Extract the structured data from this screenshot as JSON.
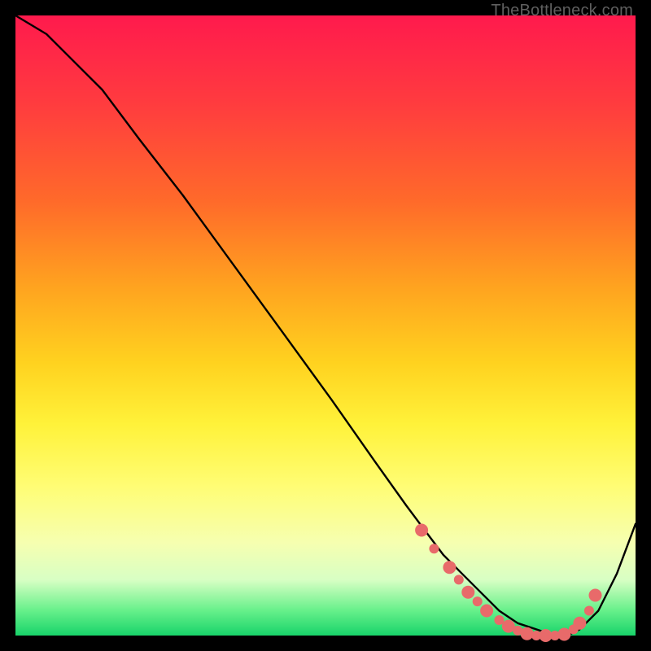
{
  "attribution": "TheBottleneck.com",
  "colors": {
    "dot": "#e86a6a",
    "line": "#000000",
    "gradient_top": "#ff1a4d",
    "gradient_bottom": "#18d36a"
  },
  "chart_data": {
    "type": "line",
    "title": "",
    "xlabel": "",
    "ylabel": "",
    "xlim": [
      0,
      100
    ],
    "ylim": [
      0,
      100
    ],
    "grid": false,
    "legend": false,
    "series": [
      {
        "name": "curve",
        "x": [
          0,
          5,
          9,
          14,
          20,
          27,
          35,
          43,
          51,
          58,
          63,
          66,
          69,
          72,
          75,
          78,
          81,
          84,
          87,
          89,
          91,
          94,
          97,
          100
        ],
        "y": [
          100,
          97,
          93,
          88,
          80,
          71,
          60,
          49,
          38,
          28,
          21,
          17,
          13,
          10,
          7,
          4,
          2,
          1,
          0,
          0,
          1,
          4,
          10,
          18
        ]
      }
    ],
    "markers": [
      {
        "x": 65.5,
        "y": 17.0,
        "size": "big"
      },
      {
        "x": 67.5,
        "y": 14.0,
        "size": "small"
      },
      {
        "x": 70.0,
        "y": 11.0,
        "size": "big"
      },
      {
        "x": 71.5,
        "y": 9.0,
        "size": "small"
      },
      {
        "x": 73.0,
        "y": 7.0,
        "size": "big"
      },
      {
        "x": 74.5,
        "y": 5.5,
        "size": "small"
      },
      {
        "x": 76.0,
        "y": 4.0,
        "size": "big"
      },
      {
        "x": 78.0,
        "y": 2.5,
        "size": "small"
      },
      {
        "x": 79.5,
        "y": 1.5,
        "size": "big"
      },
      {
        "x": 81.0,
        "y": 0.8,
        "size": "small"
      },
      {
        "x": 82.5,
        "y": 0.3,
        "size": "big"
      },
      {
        "x": 84.0,
        "y": 0.0,
        "size": "small"
      },
      {
        "x": 85.5,
        "y": 0.0,
        "size": "big"
      },
      {
        "x": 87.0,
        "y": 0.0,
        "size": "small"
      },
      {
        "x": 88.5,
        "y": 0.2,
        "size": "big"
      },
      {
        "x": 90.0,
        "y": 1.0,
        "size": "small"
      },
      {
        "x": 91.0,
        "y": 2.0,
        "size": "big"
      },
      {
        "x": 92.5,
        "y": 4.0,
        "size": "small"
      },
      {
        "x": 93.5,
        "y": 6.5,
        "size": "big"
      }
    ]
  }
}
